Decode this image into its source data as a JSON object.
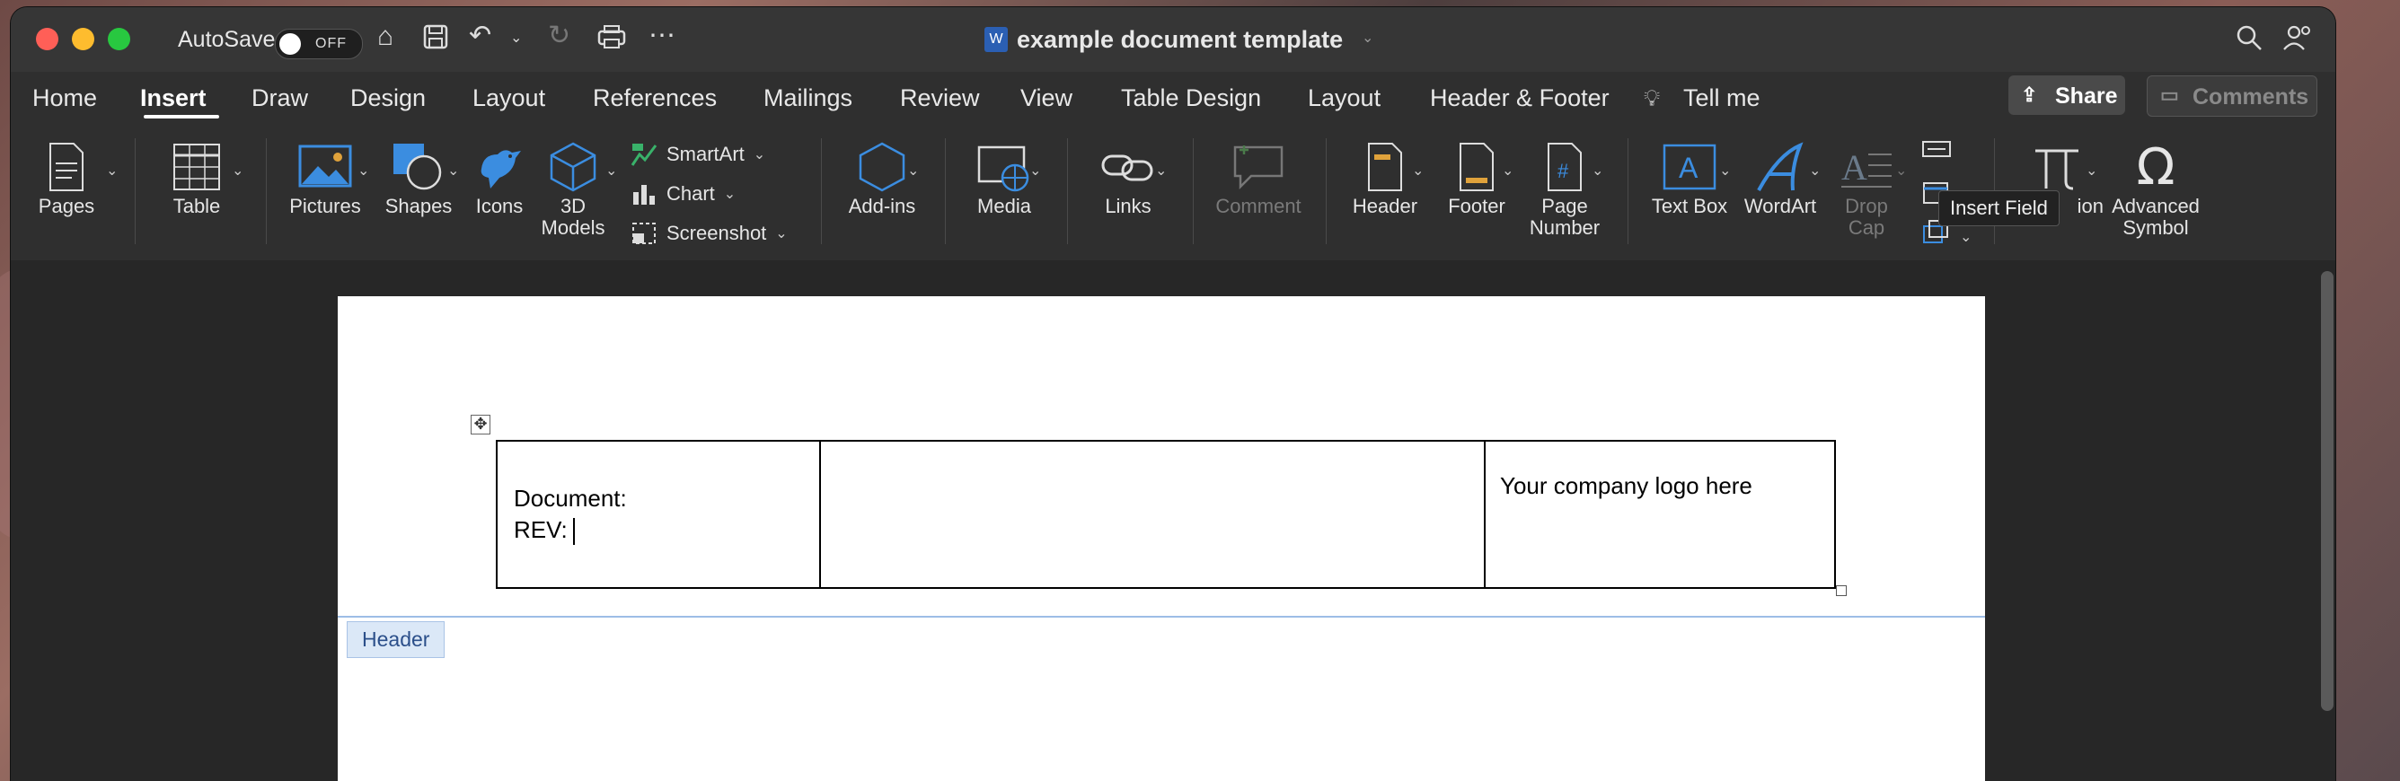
{
  "window": {
    "title": "example document template"
  },
  "titlebar": {
    "autosave_label": "AutoSave",
    "autosave_state": "OFF"
  },
  "menu": {
    "tabs": [
      "Home",
      "Insert",
      "Draw",
      "Design",
      "Layout",
      "References",
      "Mailings",
      "Review",
      "View",
      "Table Design",
      "Layout",
      "Header & Footer"
    ],
    "active_tab": "Insert",
    "tell_me": "Tell me",
    "share": "Share",
    "comments": "Comments"
  },
  "ribbon": {
    "pages": "Pages",
    "table": "Table",
    "pictures": "Pictures",
    "shapes": "Shapes",
    "icons": "Icons",
    "models_line1": "3D",
    "models_line2": "Models",
    "smartart": "SmartArt",
    "chart": "Chart",
    "screenshot": "Screenshot",
    "addins": "Add-ins",
    "media": "Media",
    "links": "Links",
    "comment": "Comment",
    "header": "Header",
    "footer": "Footer",
    "page_number_line1": "Page",
    "page_number_line2": "Number",
    "textbox": "Text Box",
    "wordart": "WordArt",
    "dropcap_line1": "Drop",
    "dropcap_line2": "Cap",
    "equation": "ion",
    "advanced_symbol_line1": "Advanced",
    "advanced_symbol_line2": "Symbol",
    "tooltip": "Insert Field"
  },
  "document": {
    "cell1_line1": "Document:",
    "cell1_line2": "REV:",
    "cell2": "",
    "cell3": "Your company logo here",
    "header_tag": "Header"
  },
  "colors": {
    "accent_blue": "#3b8de0",
    "window_bg": "#2b2b2b",
    "ribbon_bg": "#2f2f2f"
  }
}
